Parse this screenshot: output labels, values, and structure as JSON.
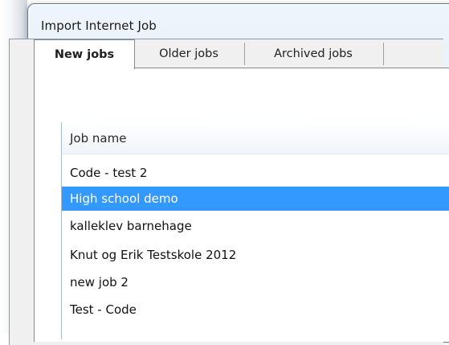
{
  "window": {
    "title": "Import Internet Job"
  },
  "tabs": [
    {
      "label": "New jobs",
      "active": true
    },
    {
      "label": "Older jobs",
      "active": false
    },
    {
      "label": "Archived jobs",
      "active": false
    }
  ],
  "list": {
    "column_header": "Job name",
    "selected_index": 1,
    "selection_color": "#3399ff",
    "rows": [
      {
        "label": "Code - test 2"
      },
      {
        "label": "High school demo"
      },
      {
        "label": "kalleklev barnehage"
      },
      {
        "label": "Knut og Erik Testskole 2012"
      },
      {
        "label": "new job 2"
      },
      {
        "label": "Test - Code"
      }
    ]
  }
}
